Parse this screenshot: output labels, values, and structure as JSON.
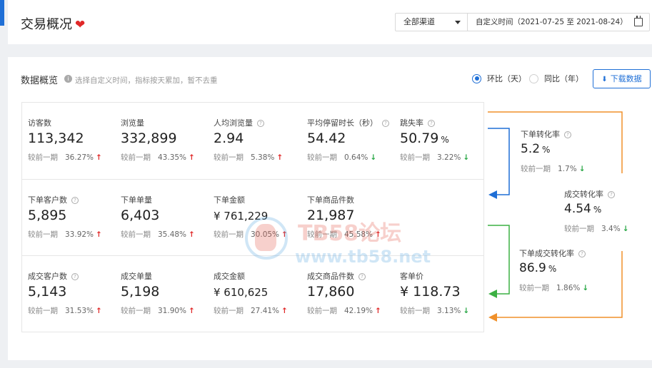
{
  "header": {
    "title": "交易概况",
    "heart_icon": "❤",
    "channel_select": "全部渠道",
    "date_range": "自定义时间（2021-07-25 至 2021-08-24）"
  },
  "overview": {
    "title": "数据概览",
    "hint": "选择自定义时间，指标按天累加，暂不去重",
    "compare_options": [
      {
        "label": "环比（天）",
        "selected": true
      },
      {
        "label": "同比（年）",
        "selected": false
      }
    ],
    "download_label": "下载数据"
  },
  "compare_label": "较前一期",
  "metrics": [
    [
      {
        "label": "访客数",
        "value": "113,342",
        "change": "36.27%",
        "trend": "up",
        "help": false
      },
      {
        "label": "浏览量",
        "value": "332,899",
        "change": "43.35%",
        "trend": "up",
        "help": false
      },
      {
        "label": "人均浏览量",
        "value": "2.94",
        "change": "5.38%",
        "trend": "up",
        "help": true
      },
      {
        "label": "平均停留时长（秒）",
        "value": "54.42",
        "change": "0.64%",
        "trend": "down",
        "help": true
      },
      {
        "label": "跳失率",
        "value": "50.79",
        "unit": "%",
        "change": "3.22%",
        "trend": "down",
        "help": true
      }
    ],
    [
      {
        "label": "下单客户数",
        "value": "5,895",
        "change": "33.92%",
        "trend": "up",
        "help": true
      },
      {
        "label": "下单单量",
        "value": "6,403",
        "change": "35.48%",
        "trend": "up",
        "help": false
      },
      {
        "label": "下单金额",
        "value": "¥ 761,229",
        "change": "30.05%",
        "trend": "up",
        "help": false,
        "money": true
      },
      {
        "label": "下单商品件数",
        "value": "21,987",
        "change": "45.58%",
        "trend": "up",
        "help": false
      }
    ],
    [
      {
        "label": "成交客户数",
        "value": "5,143",
        "change": "31.53%",
        "trend": "up",
        "help": true
      },
      {
        "label": "成交单量",
        "value": "5,198",
        "change": "31.90%",
        "trend": "up",
        "help": false
      },
      {
        "label": "成交金额",
        "value": "¥ 610,625",
        "change": "27.41%",
        "trend": "up",
        "help": false,
        "money": true
      },
      {
        "label": "成交商品件数",
        "value": "17,860",
        "change": "42.19%",
        "trend": "up",
        "help": true
      },
      {
        "label": "客单价",
        "value": "¥ 118.73",
        "change": "3.13%",
        "trend": "down",
        "help": false
      }
    ]
  ],
  "conversion_rates": [
    {
      "label": "下单转化率",
      "value": "5.2",
      "unit": "%",
      "change": "1.7%",
      "trend": "down"
    },
    {
      "label": "成交转化率",
      "value": "4.54",
      "unit": "%",
      "change": "3.4%",
      "trend": "down"
    },
    {
      "label": "下单成交转化率",
      "value": "86.9",
      "unit": "%",
      "change": "1.86%",
      "trend": "down"
    }
  ],
  "colors": {
    "accent": "#1f6fd6",
    "up": "#e02828",
    "down": "#28a745",
    "flow_blue": "#1f6fd6",
    "flow_green": "#3cb043",
    "flow_orange": "#f0902a"
  },
  "watermark": {
    "line1": "TB58论坛",
    "line2": "www.tb58.net"
  }
}
